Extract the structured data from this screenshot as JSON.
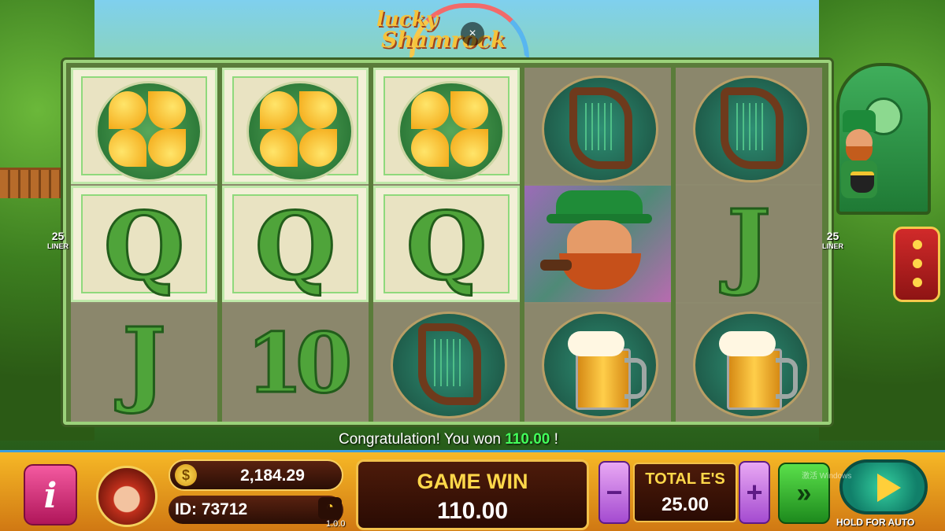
{
  "game": {
    "logo_line1": "lucky",
    "logo_line2": "Shamrock",
    "close_icon": "×"
  },
  "liners": {
    "left_count": "25",
    "left_label": "LINER",
    "right_count": "25",
    "right_label": "LINER"
  },
  "reels": [
    [
      "golden-shamrock",
      "Q",
      "J"
    ],
    [
      "golden-shamrock",
      "Q",
      "10"
    ],
    [
      "golden-shamrock",
      "Q",
      "harp"
    ],
    [
      "harp",
      "leprechaun",
      "beer-mug"
    ],
    [
      "harp",
      "J",
      "beer-mug"
    ]
  ],
  "win_highlight": [
    [
      true,
      true,
      false
    ],
    [
      true,
      true,
      false
    ],
    [
      true,
      true,
      false
    ],
    [
      false,
      false,
      false
    ],
    [
      false,
      false,
      false
    ]
  ],
  "message": {
    "prefix": "Congratulation! You won",
    "amount": "110.00",
    "suffix": "!"
  },
  "player": {
    "balance": "2,184.29",
    "id": "ID: 73712",
    "version": "1.0.0",
    "coin_icon": "$"
  },
  "game_win": {
    "label": "GAME WIN",
    "value": "110.00"
  },
  "bet": {
    "label": "TOTAL E'S",
    "value": "25.00",
    "minus": "−",
    "plus": "+"
  },
  "controls": {
    "info_label": "i",
    "fast_label": "»",
    "hold_label": "HOLD FOR AUTO"
  },
  "watermark": "激活 Windows"
}
